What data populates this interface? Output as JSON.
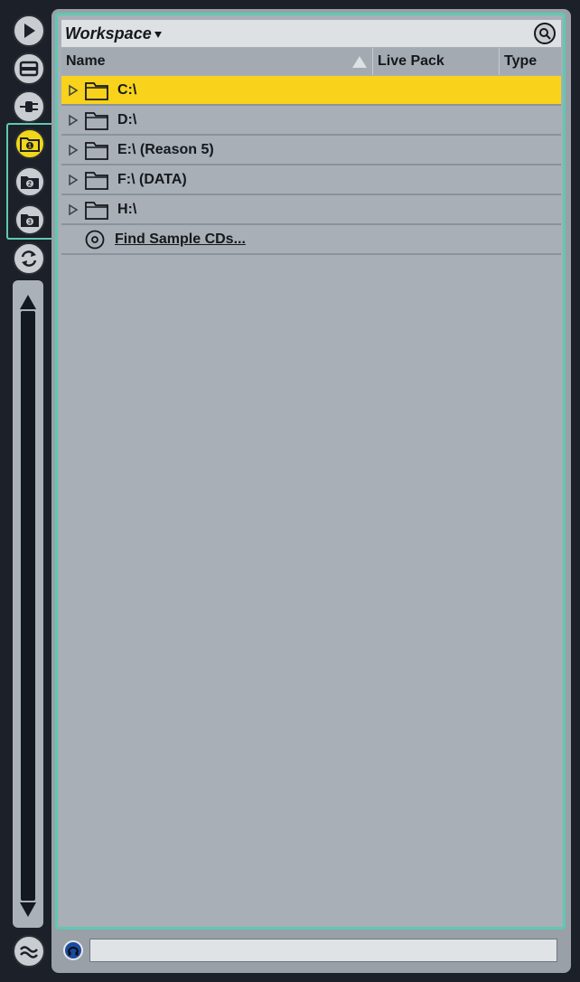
{
  "sidebar": {
    "buttons": [
      {
        "id": "play",
        "icon": "play-icon"
      },
      {
        "id": "device-view",
        "icon": "panel-icon"
      },
      {
        "id": "plugins",
        "icon": "plug-icon"
      },
      {
        "id": "folder-1",
        "icon": "folder-1-icon",
        "label": "1",
        "active": true
      },
      {
        "id": "folder-2",
        "icon": "folder-2-icon",
        "label": "2"
      },
      {
        "id": "folder-3",
        "icon": "folder-3-icon",
        "label": "3"
      },
      {
        "id": "refresh",
        "icon": "refresh-icon"
      },
      {
        "id": "waves",
        "icon": "waves-icon"
      }
    ]
  },
  "browser": {
    "title": "Workspace",
    "columns": {
      "name": "Name",
      "live_pack": "Live Pack",
      "type": "Type"
    },
    "items": [
      {
        "label": "C:\\",
        "selected": true
      },
      {
        "label": "D:\\"
      },
      {
        "label": "E:\\ (Reason 5)"
      },
      {
        "label": "F:\\ (DATA)"
      },
      {
        "label": "H:\\"
      }
    ],
    "find_sample_cds": "Find Sample CDs..."
  },
  "status": {
    "field_value": ""
  },
  "colors": {
    "accent": "#5fc8b3",
    "selection": "#f8d21b",
    "panel": "#a8afb6",
    "background": "#1c2028"
  }
}
